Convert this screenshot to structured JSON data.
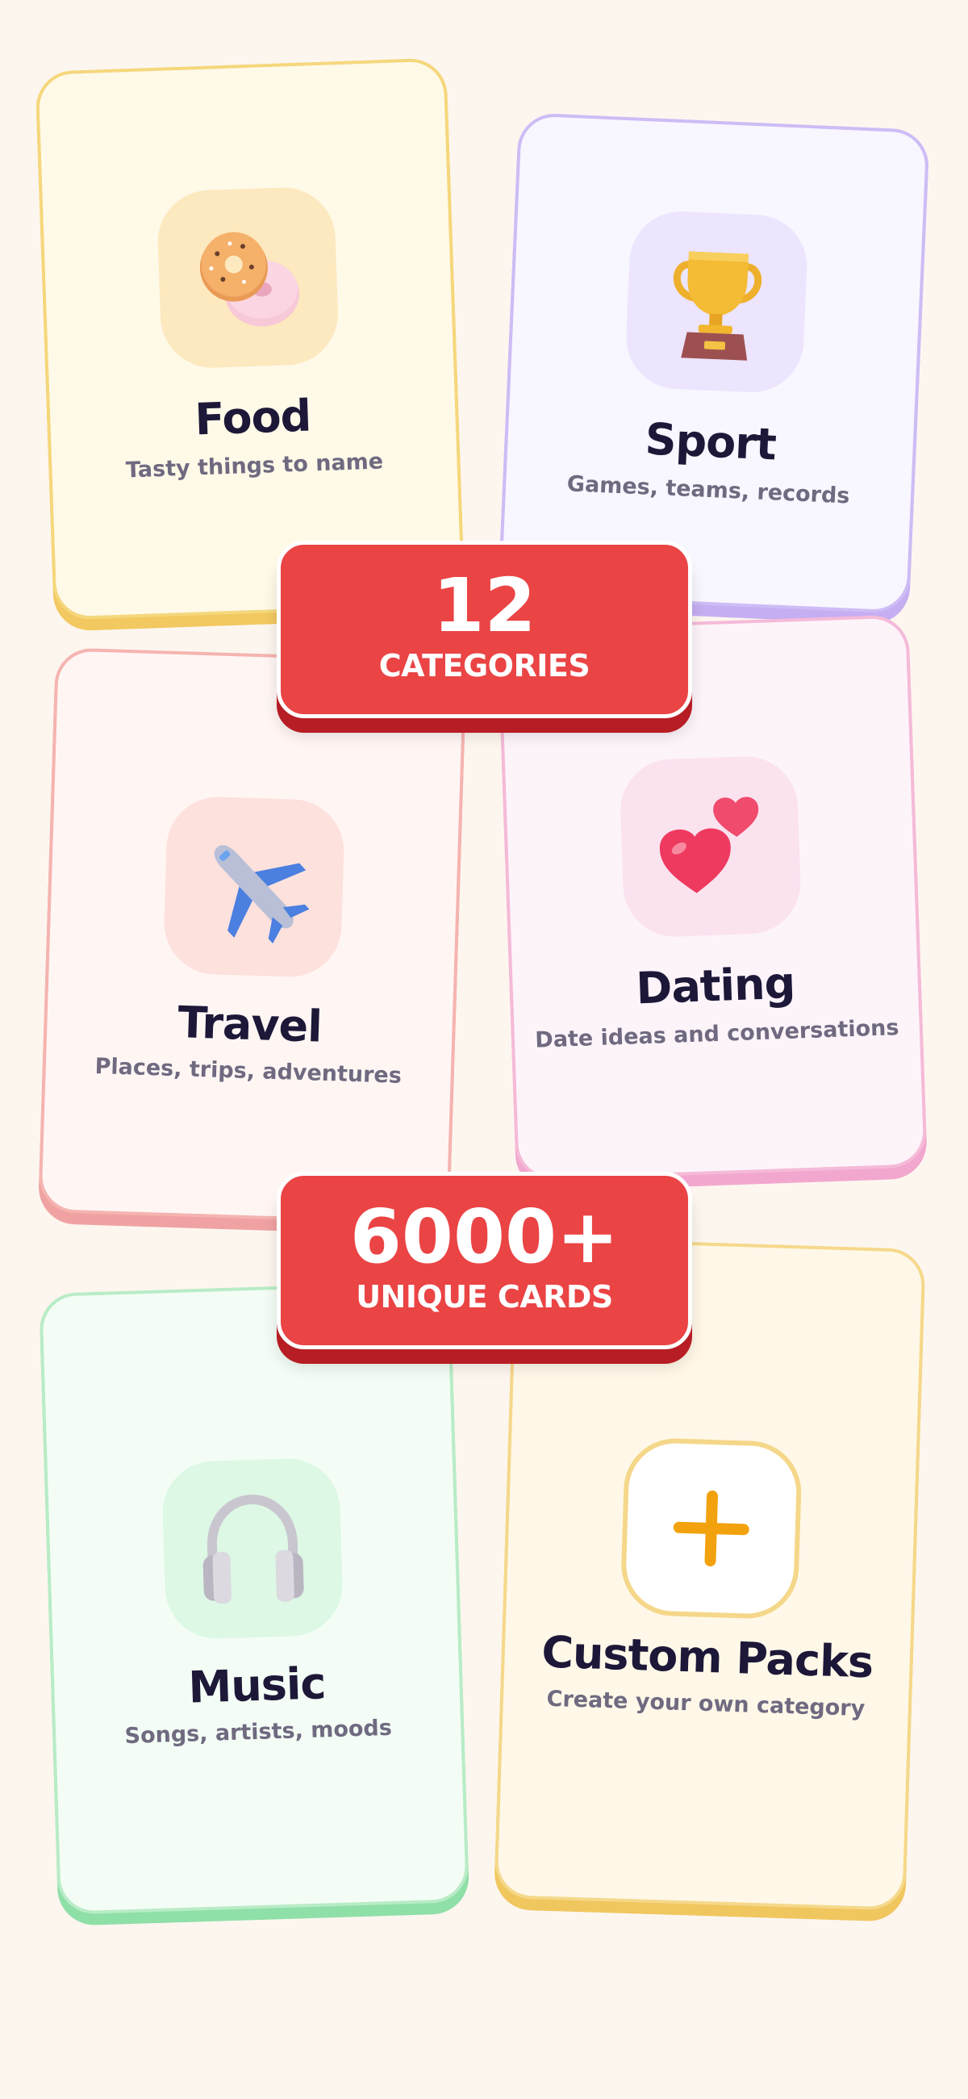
{
  "categories": [
    {
      "title": "Food",
      "subtitle": "Tasty things to name",
      "icon": "donut-icon"
    },
    {
      "title": "Sport",
      "subtitle": "Games, teams, records",
      "icon": "trophy-icon"
    },
    {
      "title": "Travel",
      "subtitle": "Places, trips, adventures",
      "icon": "airplane-icon"
    },
    {
      "title": "Dating",
      "subtitle": "Date ideas and conversations",
      "icon": "hearts-icon"
    },
    {
      "title": "Music",
      "subtitle": "Songs, artists, moods",
      "icon": "headphones-icon"
    },
    {
      "title": "Custom Packs",
      "subtitle": "Create your own category",
      "icon": "plus-icon"
    }
  ],
  "badges": {
    "categories": {
      "number": "12",
      "label": "CATEGORIES"
    },
    "cards": {
      "number": "6000+",
      "label": "UNIQUE CARDS"
    }
  },
  "colors": {
    "background": "#fdf6ef",
    "badge": "#ea4445",
    "title_text": "#1d1838",
    "subtitle_text": "#6f6a80"
  }
}
